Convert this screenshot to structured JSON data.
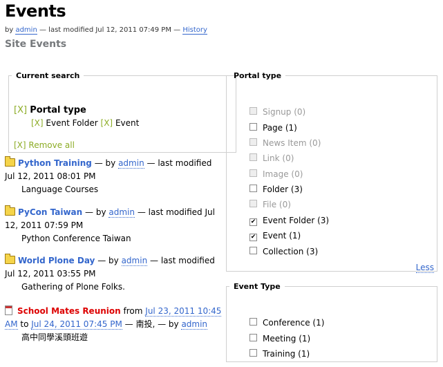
{
  "page": {
    "title": "Events",
    "byline": {
      "by": "by",
      "author": "admin",
      "modified": "— last modified Jul 12, 2011 07:49 PM —",
      "history": "History"
    },
    "subtitle": "Site Events"
  },
  "current_search": {
    "legend": "Current search",
    "portal_type_x": "[X]",
    "portal_type_label": "Portal type",
    "selected": [
      {
        "x": "[X]",
        "label": "Event Folder"
      },
      {
        "x": "[X]",
        "label": "Event"
      }
    ],
    "remove_all": "[X] Remove all"
  },
  "events": [
    {
      "title": "Python Training",
      "by": "— by",
      "author": "admin",
      "rest": "— last modified Jul 12, 2011 08:01 PM",
      "desc": "Language Courses"
    },
    {
      "title": "PyCon Taiwan",
      "by": "— by",
      "author": "admin",
      "rest": "— last modified Jul 12, 2011 07:59 PM",
      "desc": "Python Conference Taiwan"
    },
    {
      "title": "World Plone Day",
      "by": "— by",
      "author": "admin",
      "rest": "— last modified Jul 12, 2011 03:55 PM",
      "desc": "Gathering of Plone Folks."
    },
    {
      "title": "School Mates Reunion",
      "from_word": "from",
      "start": "Jul 23, 2011 10:45 AM",
      "to_word": "to",
      "end": "Jul 24, 2011 07:45 PM",
      "location": "— 南投, — by",
      "author": "admin",
      "desc": "高中同學溪頭班遊"
    }
  ],
  "portal_type": {
    "legend": "Portal type",
    "options": [
      {
        "label": "Signup (0)",
        "checked": false,
        "disabled": true
      },
      {
        "label": "Page (1)",
        "checked": false,
        "disabled": false
      },
      {
        "label": "News Item (0)",
        "checked": false,
        "disabled": true
      },
      {
        "label": "Link (0)",
        "checked": false,
        "disabled": true
      },
      {
        "label": "Image (0)",
        "checked": false,
        "disabled": true
      },
      {
        "label": "Folder (3)",
        "checked": false,
        "disabled": false
      },
      {
        "label": "File (0)",
        "checked": false,
        "disabled": true
      },
      {
        "label": "Event Folder (3)",
        "checked": true,
        "disabled": false
      },
      {
        "label": "Event (1)",
        "checked": true,
        "disabled": false
      },
      {
        "label": "Collection (3)",
        "checked": false,
        "disabled": false
      }
    ],
    "less": "Less"
  },
  "event_type": {
    "legend": "Event Type",
    "options": [
      {
        "label": "Conference (1)",
        "checked": false
      },
      {
        "label": "Meeting (1)",
        "checked": false
      },
      {
        "label": "Training (1)",
        "checked": false
      }
    ]
  },
  "colors": {
    "link": "#3366cc",
    "facet_x": "#8cac25",
    "event_red": "#dd0000",
    "subtitle": "#76797c"
  }
}
